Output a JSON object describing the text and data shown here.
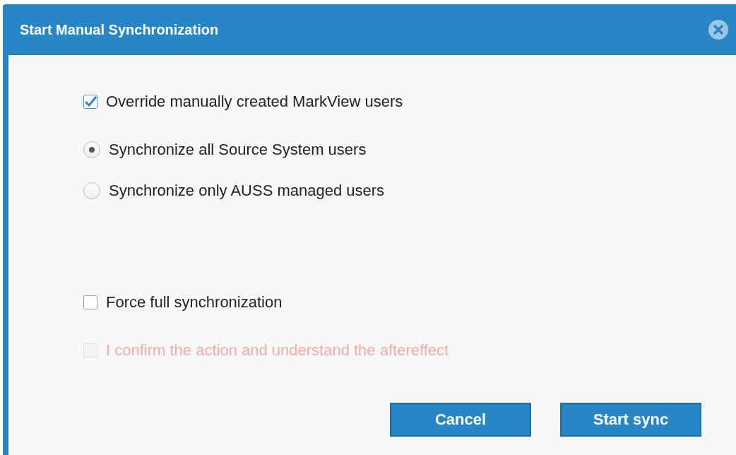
{
  "dialog": {
    "title": "Start Manual Synchronization"
  },
  "options": [
    {
      "kind": "checkbox",
      "label": "Override manually created MarkView users",
      "checked": true,
      "disabled": false
    }
  ],
  "scope": [
    {
      "kind": "radio",
      "label": "Synchronize all Source System users",
      "selected": true,
      "disabled": false
    },
    {
      "kind": "radio",
      "label": "Synchronize only AUSS managed users",
      "selected": false,
      "disabled": false
    }
  ],
  "safeguards": [
    {
      "kind": "checkbox",
      "label": "Force full synchronization",
      "checked": false,
      "disabled": false
    },
    {
      "kind": "checkbox",
      "label": "I confirm the action and understand the aftereffect",
      "checked": false,
      "disabled": true
    }
  ],
  "buttons": [
    {
      "label": "Cancel"
    },
    {
      "label": "Start sync"
    }
  ]
}
